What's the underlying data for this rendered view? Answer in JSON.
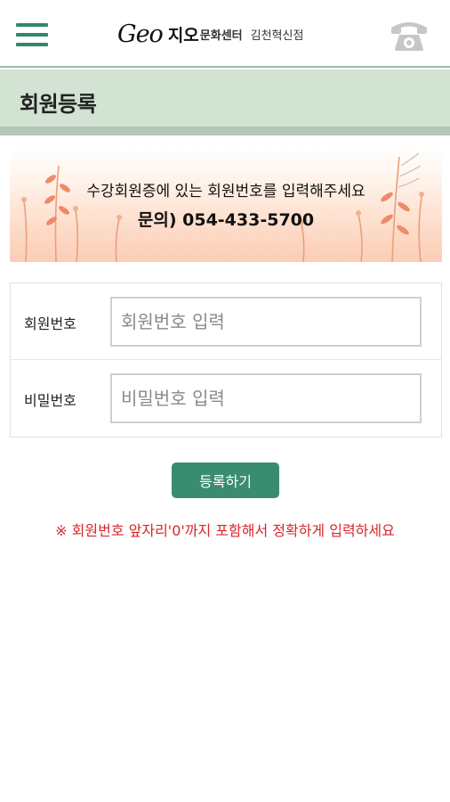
{
  "header": {
    "logo_mark": "Geo",
    "logo_name": "지오",
    "logo_sub": "문화센터",
    "branch": "김천혁신점"
  },
  "page": {
    "title": "회원등록"
  },
  "banner": {
    "line1": "수강회원증에 있는 회원번호를 입력해주세요",
    "line2": "문의) 054-433-5700"
  },
  "form": {
    "member_label": "회원번호",
    "member_placeholder": "회원번호 입력",
    "password_label": "비밀번호",
    "password_placeholder": "비밀번호 입력"
  },
  "actions": {
    "submit_label": "등록하기"
  },
  "notice": {
    "text": "※ 회원번호 앞자리'0'까지 포함해서 정확하게 입력하세요"
  },
  "colors": {
    "brand_green": "#3a8c70",
    "title_bg": "#d2e3d3",
    "notice_red": "#d8262a"
  },
  "icons": {
    "menu": "hamburger-menu-icon",
    "phone": "telephone-icon"
  }
}
